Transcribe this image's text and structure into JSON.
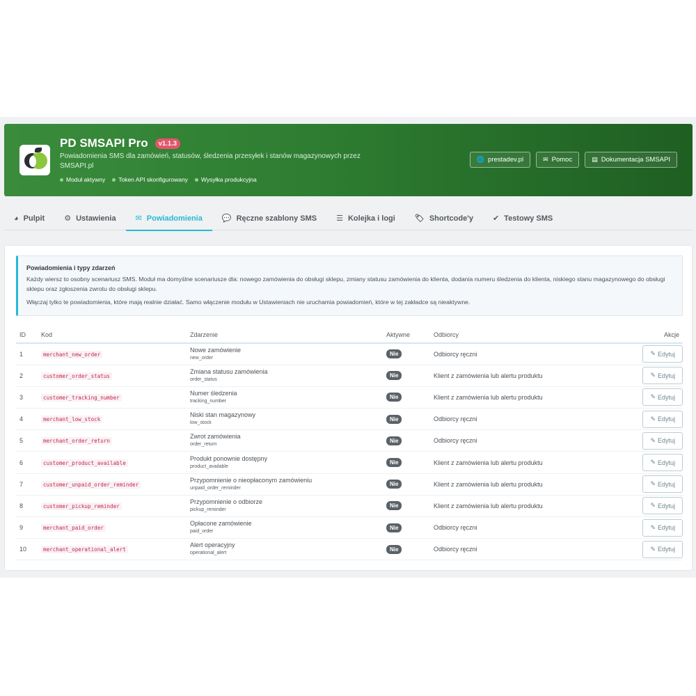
{
  "header": {
    "title": "PD SMSAPI Pro",
    "version": "v1.1.3",
    "subtitle": "Powiadomienia SMS dla zamówień, statusów, śledzenia przesyłek i stanów magazynowych przez SMSAPI.pl",
    "status": [
      "Moduł aktywny",
      "Token API skonfigurowany",
      "Wysyłka produkcyjna"
    ],
    "buttons": [
      {
        "label": "prestadev.pl",
        "icon": "globe-icon"
      },
      {
        "label": "Pomoc",
        "icon": "envelope-icon"
      },
      {
        "label": "Dokumentacja SMSAPI",
        "icon": "book-icon"
      }
    ]
  },
  "tabs": [
    {
      "label": "Pulpit",
      "icon": "dashboard-icon"
    },
    {
      "label": "Ustawienia",
      "icon": "cogs-icon"
    },
    {
      "label": "Powiadomienia",
      "icon": "envelope-icon",
      "active": true
    },
    {
      "label": "Ręczne szablony SMS",
      "icon": "comments-icon"
    },
    {
      "label": "Kolejka i logi",
      "icon": "list-icon"
    },
    {
      "label": "Shortcode'y",
      "icon": "tags-icon"
    },
    {
      "label": "Testowy SMS",
      "icon": "check-icon"
    }
  ],
  "info": {
    "title": "Powiadomienia i typy zdarzeń",
    "text1": "Każdy wiersz to osobny scenariusz SMS. Moduł ma domyślne scenariusze dla: nowego zamówienia do obsługi sklepu, zmiany statusu zamówienia do klienta, dodania numeru śledzenia do klienta, niskiego stanu magazynowego do obsługi sklepu oraz zgłoszenia zwrotu do obsługi sklepu.",
    "text2": "Włączaj tylko te powiadomienia, które mają realnie działać. Samo włączenie modułu w Ustawieniach nie uruchamia powiadomień, które w tej zakładce są nieaktywne."
  },
  "table": {
    "headers": {
      "id": "ID",
      "code": "Kod",
      "event": "Zdarzenie",
      "active": "Aktywne",
      "recipients": "Odbiorcy",
      "actions": "Akcje"
    },
    "edit_label": "Edytuj",
    "rows": [
      {
        "id": "1",
        "code": "merchant_new_order",
        "event": "Nowe zamówienie",
        "event_key": "new_order",
        "active": "Nie",
        "recipients": "Odbiorcy ręczni"
      },
      {
        "id": "2",
        "code": "customer_order_status",
        "event": "Zmiana statusu zamówienia",
        "event_key": "order_status",
        "active": "Nie",
        "recipients": "Klient z zamówienia lub alertu produktu"
      },
      {
        "id": "3",
        "code": "customer_tracking_number",
        "event": "Numer śledzenia",
        "event_key": "tracking_number",
        "active": "Nie",
        "recipients": "Klient z zamówienia lub alertu produktu"
      },
      {
        "id": "4",
        "code": "merchant_low_stock",
        "event": "Niski stan magazynowy",
        "event_key": "low_stock",
        "active": "Nie",
        "recipients": "Odbiorcy ręczni"
      },
      {
        "id": "5",
        "code": "merchant_order_return",
        "event": "Zwrot zamówienia",
        "event_key": "order_return",
        "active": "Nie",
        "recipients": "Odbiorcy ręczni"
      },
      {
        "id": "6",
        "code": "customer_product_available",
        "event": "Produkt ponownie dostępny",
        "event_key": "product_available",
        "active": "Nie",
        "recipients": "Klient z zamówienia lub alertu produktu"
      },
      {
        "id": "7",
        "code": "customer_unpaid_order_reminder",
        "event": "Przypomnienie o nieopłaconym zamówieniu",
        "event_key": "unpaid_order_reminder",
        "active": "Nie",
        "recipients": "Klient z zamówienia lub alertu produktu"
      },
      {
        "id": "8",
        "code": "customer_pickup_reminder",
        "event": "Przypomnienie o odbiorze",
        "event_key": "pickup_reminder",
        "active": "Nie",
        "recipients": "Klient z zamówienia lub alertu produktu"
      },
      {
        "id": "9",
        "code": "merchant_paid_order",
        "event": "Opłacone zamówienie",
        "event_key": "paid_order",
        "active": "Nie",
        "recipients": "Odbiorcy ręczni"
      },
      {
        "id": "10",
        "code": "merchant_operational_alert",
        "event": "Alert operacyjny",
        "event_key": "operational_alert",
        "active": "Nie",
        "recipients": "Odbiorcy ręczni"
      }
    ]
  }
}
